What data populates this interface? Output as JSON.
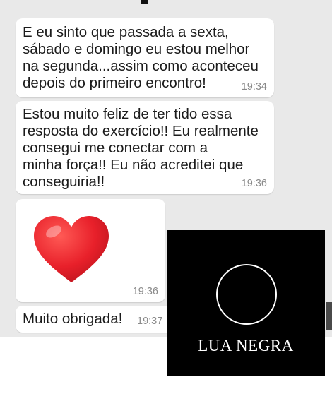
{
  "chat": {
    "messages": [
      {
        "text": "E eu sinto que passada a sexta,\nsábado e domingo eu estou melhor\nna segunda...assim como aconteceu\ndepois do primeiro encontro!",
        "time": "19:34"
      },
      {
        "text": "Estou muito feliz de ter tido essa\nresposta do  exercício!! Eu realmente\nconsegui me conectar com a\nminha força!! Eu não acreditei que\nconseguiria!!",
        "time": "19:36"
      },
      {
        "emoji": "red-heart",
        "time": "19:36"
      },
      {
        "text": "Muito obrigada!",
        "time": "19:37"
      }
    ]
  },
  "logo": {
    "text": "LUA NEGRA",
    "icon": "circle-moon-icon"
  },
  "colors": {
    "chat_background": "#e9e9e9",
    "bubble": "#ffffff",
    "timestamp": "#8a8a8a",
    "heart": "#e8202a",
    "logo_background": "#000000"
  }
}
